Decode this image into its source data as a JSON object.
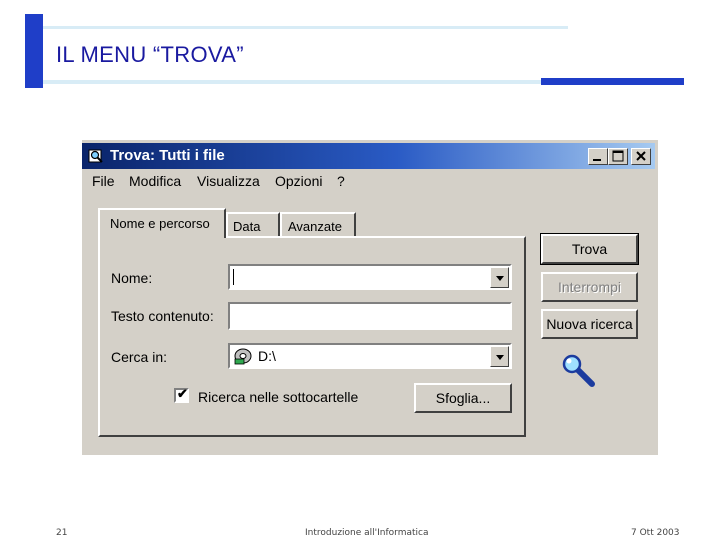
{
  "slide": {
    "title": "IL MENU “TROVA”",
    "footer_page": "21",
    "footer_center": "Introduzione all'Informatica",
    "footer_date": "7 Ott 2003"
  },
  "window": {
    "title": "Trova: Tutti i file",
    "menu": [
      "File",
      "Modifica",
      "Visualizza",
      "Opzioni",
      "?"
    ],
    "tabs": [
      "Nome e percorso",
      "Data",
      "Avanzate"
    ],
    "fields": {
      "name_label": "Nome:",
      "name_value": "",
      "text_label": "Testo contenuto:",
      "text_value": "",
      "lookin_label": "Cerca in:",
      "lookin_value": "D:\\"
    },
    "subfolders_label": "Ricerca nelle sottocartelle",
    "subfolders_checked": true,
    "browse_label": "Sfoglia...",
    "buttons": {
      "find": "Trova",
      "stop": "Interrompi",
      "new_search": "Nuova ricerca"
    },
    "icons": [
      "search-window-icon",
      "drive-icon",
      "magnifier-icon"
    ]
  }
}
